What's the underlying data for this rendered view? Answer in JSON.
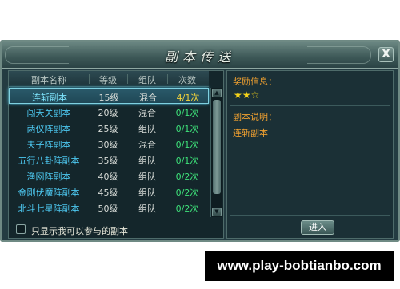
{
  "window": {
    "title": "副本传送",
    "close_label": "X"
  },
  "list": {
    "columns": [
      "副本名称",
      "等级",
      "组队",
      "次数"
    ],
    "rows": [
      {
        "name": "连斩副本",
        "level": "15级",
        "team": "混合",
        "count": "4/1次",
        "selected": true
      },
      {
        "name": "闯天关副本",
        "level": "20级",
        "team": "混合",
        "count": "0/1次"
      },
      {
        "name": "两仪阵副本",
        "level": "25级",
        "team": "组队",
        "count": "0/1次"
      },
      {
        "name": "夫子阵副本",
        "level": "30级",
        "team": "混合",
        "count": "0/1次"
      },
      {
        "name": "五行八卦阵副本",
        "level": "35级",
        "team": "组队",
        "count": "0/1次"
      },
      {
        "name": "渔网阵副本",
        "level": "40级",
        "team": "组队",
        "count": "0/2次"
      },
      {
        "name": "金刚伏魔阵副本",
        "level": "45级",
        "team": "组队",
        "count": "0/2次"
      },
      {
        "name": "北斗七星阵副本",
        "level": "50级",
        "team": "组队",
        "count": "0/2次"
      }
    ],
    "filter_label": "只显示我可以参与的副本"
  },
  "info": {
    "reward_heading": "奖励信息：",
    "stars": "★★☆",
    "desc_heading": "副本说明：",
    "desc_text": "连斩副本",
    "enter_label": "进入"
  },
  "watermark": "www.play-bobtianbo.com"
}
